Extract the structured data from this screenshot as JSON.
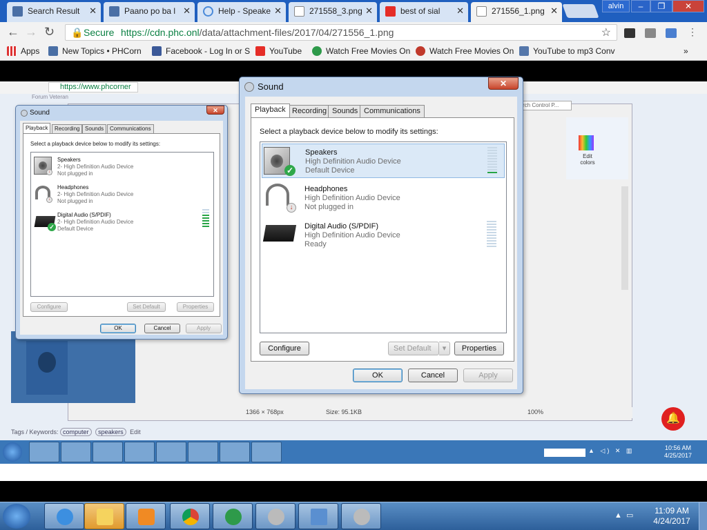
{
  "browser": {
    "tabs": [
      {
        "label": "Search Result",
        "icon": "phc-icon",
        "color": "#4a6fa5"
      },
      {
        "label": "Paano po ba l",
        "icon": "phc-icon",
        "color": "#4a6fa5"
      },
      {
        "label": "Help - Speake",
        "icon": "loading-icon",
        "color": "#4a8ad9"
      },
      {
        "label": "271558_3.png",
        "icon": "file-icon",
        "color": "#dddddd"
      },
      {
        "label": "best of sial",
        "icon": "youtube-icon",
        "color": "#e52d27"
      },
      {
        "label": "271556_1.png",
        "icon": "file-icon",
        "color": "#dddddd"
      }
    ],
    "user": "alvin",
    "secure_label": "Secure",
    "url_host": "https://cdn.phc.onl",
    "url_path": "/data/attachment-files/2017/04/271556_1.png",
    "bookmarks": [
      {
        "label": "Apps",
        "icon": "apps-icon",
        "color": "#d33"
      },
      {
        "label": "New Topics • PHCorn",
        "icon": "phc-icon",
        "color": "#4a6fa5"
      },
      {
        "label": "Facebook - Log In or S",
        "icon": "facebook-icon",
        "color": "#3b5998"
      },
      {
        "label": "YouTube",
        "icon": "youtube-icon",
        "color": "#e52d27"
      },
      {
        "label": "Watch Free Movies On",
        "icon": "play-icon",
        "color": "#2e9a4a"
      },
      {
        "label": "Watch Free Movies On",
        "icon": "movie-icon",
        "color": "#c0392b"
      },
      {
        "label": "YouTube to mp3 Conv",
        "icon": "mp3-icon",
        "color": "#5577aa"
      }
    ],
    "more_bookmarks": "»"
  },
  "inner": {
    "url": "https://www.phcorner",
    "forum_label": "Forum Veteran",
    "tags_label": "Tags / Keywords:",
    "tags": [
      "computer",
      "speakers"
    ],
    "edit_label": "Edit",
    "status_dims": "1366 × 768px",
    "status_size": "Size: 95.1KB",
    "zoom": "100%",
    "search_placeholder": "rch Control P...",
    "edit_colors": "Edit colors",
    "clock_time": "10:56 AM",
    "clock_date": "4/25/2017"
  },
  "small_dialog": {
    "title": "Sound",
    "tabs": [
      "Playback",
      "Recording",
      "Sounds",
      "Communications"
    ],
    "instruction": "Select a playback device below to modify its settings:",
    "devices": [
      {
        "name": "Speakers",
        "desc": "2- High Definition Audio Device",
        "status": "Not plugged in"
      },
      {
        "name": "Headphones",
        "desc": "2- High Definition Audio Device",
        "status": "Not plugged in"
      },
      {
        "name": "Digital Audio (S/PDIF)",
        "desc": "2- High Definition Audio Device",
        "status": "Default Device"
      }
    ],
    "configure": "Configure",
    "set_default": "Set Default",
    "properties": "Properties",
    "ok": "OK",
    "cancel": "Cancel",
    "apply": "Apply"
  },
  "dialog": {
    "title": "Sound",
    "close": "✕",
    "tabs": [
      "Playback",
      "Recording",
      "Sounds",
      "Communications"
    ],
    "instruction": "Select a playback device below to modify its settings:",
    "devices": [
      {
        "name": "Speakers",
        "desc": "High Definition Audio Device",
        "status": "Default Device",
        "level": 0.15
      },
      {
        "name": "Headphones",
        "desc": "High Definition Audio Device",
        "status": "Not plugged in"
      },
      {
        "name": "Digital Audio (S/PDIF)",
        "desc": "High Definition Audio Device",
        "status": "Ready",
        "level": 0
      }
    ],
    "configure": "Configure",
    "set_default": "Set Default",
    "properties": "Properties",
    "ok": "OK",
    "cancel": "Cancel",
    "apply": "Apply"
  },
  "taskbar": {
    "time": "11:09 AM",
    "date": "4/24/2017",
    "apps": [
      "internet-explorer-icon",
      "file-explorer-icon",
      "media-player-icon",
      "chrome-icon",
      "download-manager-icon",
      "sound-icon",
      "control-panel-icon",
      "sound-icon"
    ]
  }
}
